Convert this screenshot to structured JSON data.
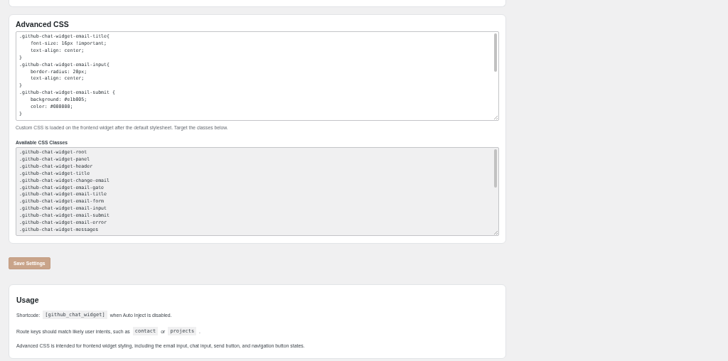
{
  "advanced_css": {
    "title": "Advanced CSS",
    "editor_value": ".github-chat-widget-email-title{\n    font-size: 16px !important;\n    text-align: center;\n}\n.github-chat-widget-email-input{\n    border-radius: 20px;\n    text-align: center;\n}\n.github-chat-widget-email-submit {\n    background: #e1b005;\n    color: #000000;\n}",
    "help": "Custom CSS is loaded on the frontend widget after the default stylesheet. Target the classes below.",
    "classes_label": "Available CSS Classes",
    "classes_value": ".github-chat-widget-root\n.github-chat-widget-panel\n.github-chat-widget-header\n.github-chat-widget-title\n.github-chat-widget-change-email\n.github-chat-widget-email-gate\n.github-chat-widget-email-title\n.github-chat-widget-email-form\n.github-chat-widget-email-input\n.github-chat-widget-email-submit\n.github-chat-widget-email-error\n.github-chat-widget-messages"
  },
  "save_button": {
    "label": "Save Settings",
    "disabled": true
  },
  "usage": {
    "title": "Usage",
    "paragraphs": [
      [
        {
          "kind": "text",
          "text": "Shortcode:"
        },
        {
          "kind": "code",
          "text": "[github_chat_widget]"
        },
        {
          "kind": "text",
          "text": "when Auto Inject is disabled."
        }
      ],
      [
        {
          "kind": "text",
          "text": "Route keys should match likely user intents, such as"
        },
        {
          "kind": "code",
          "text": "contact"
        },
        {
          "kind": "text",
          "text": "or"
        },
        {
          "kind": "code",
          "text": "projects"
        },
        {
          "kind": "text",
          "text": "."
        }
      ],
      [
        {
          "kind": "text",
          "text": "Advanced CSS is intended for frontend widget styling, including the email input, chat input, send button, and navigation button states."
        }
      ]
    ]
  }
}
